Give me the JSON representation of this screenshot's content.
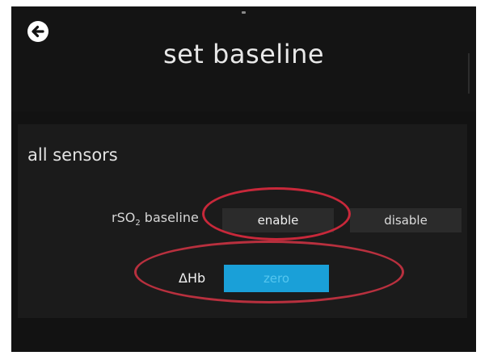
{
  "header": {
    "title": "set baseline",
    "back_icon": "arrow-left-circle-icon"
  },
  "panel": {
    "section_title": "all sensors",
    "rso2": {
      "label_prefix": "rSO",
      "label_sub": "2",
      "label_suffix": " baseline",
      "enable_label": "enable",
      "disable_label": "disable"
    },
    "hb": {
      "label": "ΔHb",
      "zero_label": "zero"
    }
  },
  "colors": {
    "background": "#121212",
    "panel": "#1b1b1b",
    "button": "#2b2b2b",
    "accent": "#1aa0d8",
    "annotation": "#c8283a"
  }
}
